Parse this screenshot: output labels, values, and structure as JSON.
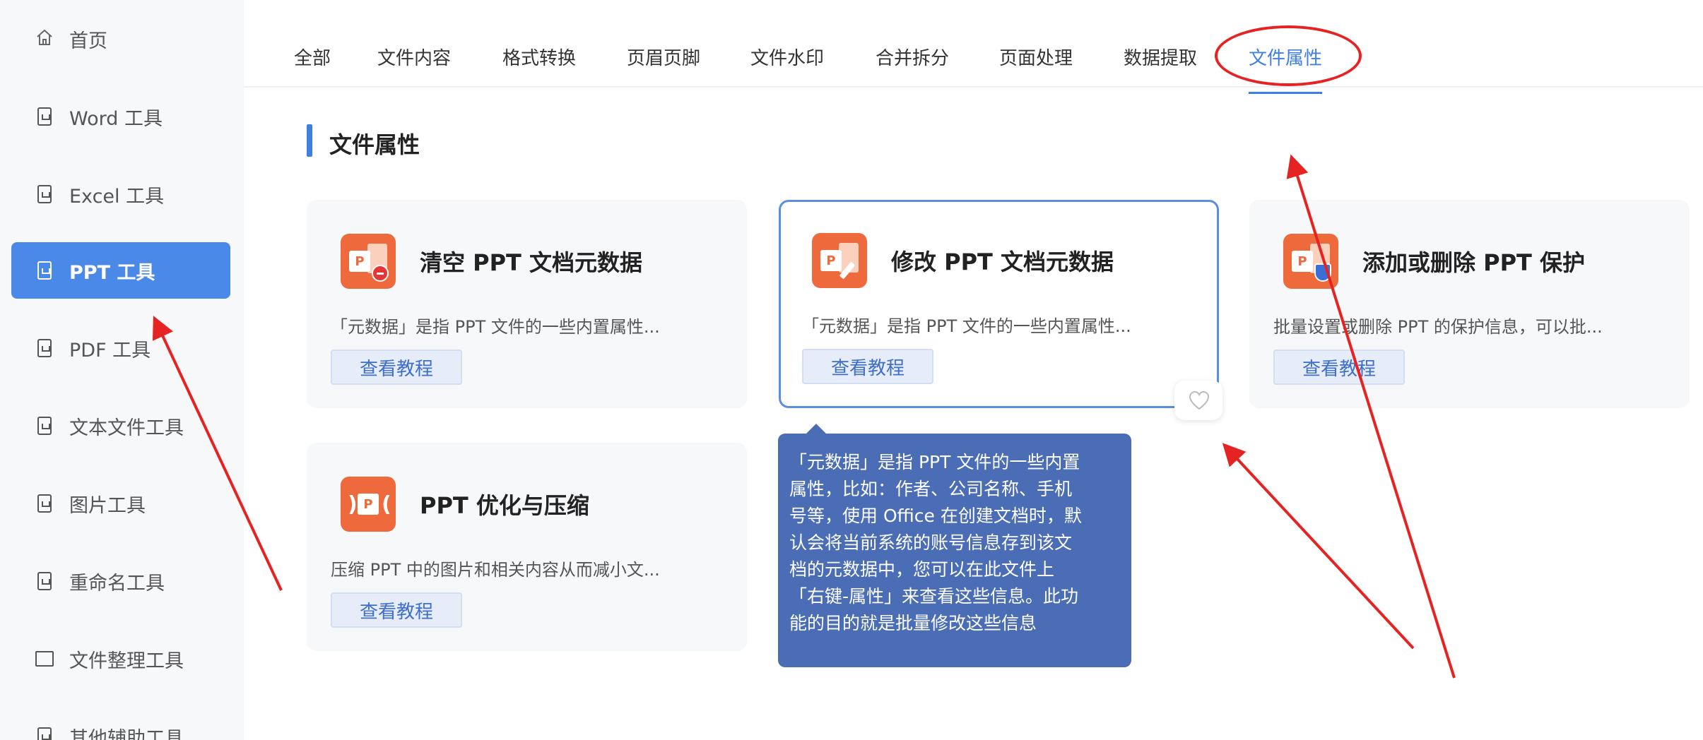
{
  "sidebar": {
    "items": [
      {
        "label": "首页",
        "icon": "home-icon",
        "active": false
      },
      {
        "label": "Word 工具",
        "icon": "word-doc-icon",
        "active": false
      },
      {
        "label": "Excel 工具",
        "icon": "excel-doc-icon",
        "active": false
      },
      {
        "label": "PPT 工具",
        "icon": "ppt-doc-icon",
        "active": true
      },
      {
        "label": "PDF 工具",
        "icon": "pdf-doc-icon",
        "active": false
      },
      {
        "label": "文本文件工具",
        "icon": "text-doc-icon",
        "active": false
      },
      {
        "label": "图片工具",
        "icon": "image-doc-icon",
        "active": false
      },
      {
        "label": "重命名工具",
        "icon": "rename-icon",
        "active": false
      },
      {
        "label": "文件整理工具",
        "icon": "folder-icon",
        "active": false
      },
      {
        "label": "其他辅助工具",
        "icon": "misc-tool-icon",
        "active": false
      }
    ]
  },
  "tabs": [
    {
      "label": "全部",
      "active": false
    },
    {
      "label": "文件内容",
      "active": false
    },
    {
      "label": "格式转换",
      "active": false
    },
    {
      "label": "页眉页脚",
      "active": false
    },
    {
      "label": "文件水印",
      "active": false
    },
    {
      "label": "合并拆分",
      "active": false
    },
    {
      "label": "页面处理",
      "active": false
    },
    {
      "label": "数据提取",
      "active": false
    },
    {
      "label": "文件属性",
      "active": true
    }
  ],
  "section": {
    "title": "文件属性"
  },
  "cards": [
    {
      "title": "清空 PPT 文档元数据",
      "desc": "「元数据」是指 PPT 文件的一些内置属性...",
      "button": "查看教程",
      "icon": "ppt-clear-metadata-icon"
    },
    {
      "title": "修改 PPT 文档元数据",
      "desc": "「元数据」是指 PPT 文件的一些内置属性...",
      "button": "查看教程",
      "icon": "ppt-edit-metadata-icon"
    },
    {
      "title": "添加或删除 PPT 保护",
      "desc": "批量设置或删除 PPT 的保护信息，可以批...",
      "button": "查看教程",
      "icon": "ppt-protect-icon"
    },
    {
      "title": "PPT 优化与压缩",
      "desc": "压缩 PPT 中的图片和相关内容从而减小文...",
      "button": "查看教程",
      "icon": "ppt-compress-icon"
    }
  ],
  "tooltip": {
    "lines": [
      "「元数据」是指 PPT 文件的一些内置",
      "属性，比如：作者、公司名称、手机",
      "号等，使用 Office 在创建文档时，默",
      "认会将当前系统的账号信息存到该文",
      "档的元数据中，您可以在此文件上",
      "「右键-属性」来查看这些信息。此功",
      "能的目的就是批量修改这些信息"
    ]
  },
  "colors": {
    "accent": "#3f7fe0",
    "sidebar_active": "#4a89e8",
    "tooltip_bg": "#4a6db6",
    "ppt_orange": "#ee6a3c",
    "annotation_red": "#e52323"
  }
}
